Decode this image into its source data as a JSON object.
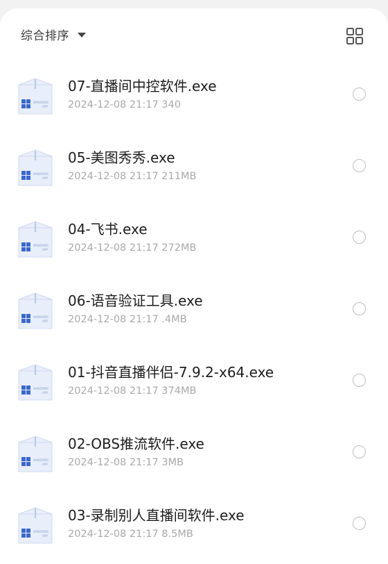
{
  "toolbar": {
    "sort_label": "综合排序",
    "sort_icon": "caret-down-icon",
    "view_icon": "grid-view-icon"
  },
  "icon_text": {
    "line1": "WINDOWS",
    "line2": "APP"
  },
  "files": [
    {
      "name": "07-直播间中控软件.exe",
      "date": "2024-12-08 21:17",
      "size": "340"
    },
    {
      "name": "05-美图秀秀.exe",
      "date": "2024-12-08 21:17",
      "size": "211MB"
    },
    {
      "name": "04-飞书.exe",
      "date": "2024-12-08 21:17",
      "size": "272MB"
    },
    {
      "name": "06-语音验证工具.exe",
      "date": "2024-12-08 21:17",
      "size": ".4MB"
    },
    {
      "name": "01-抖音直播伴侣-7.9.2-x64.exe",
      "date": "2024-12-08 21:17",
      "size": "374MB"
    },
    {
      "name": "02-OBS推流软件.exe",
      "date": "2024-12-08 21:17",
      "size": "3MB"
    },
    {
      "name": "03-录制别人直播间软件.exe",
      "date": "2024-12-08 21:17",
      "size": "8.5MB"
    }
  ],
  "colors": {
    "background": "#f2f2f2",
    "panel": "#ffffff",
    "icon_blue": "#3b68c9",
    "icon_body": "#dde6f7"
  }
}
